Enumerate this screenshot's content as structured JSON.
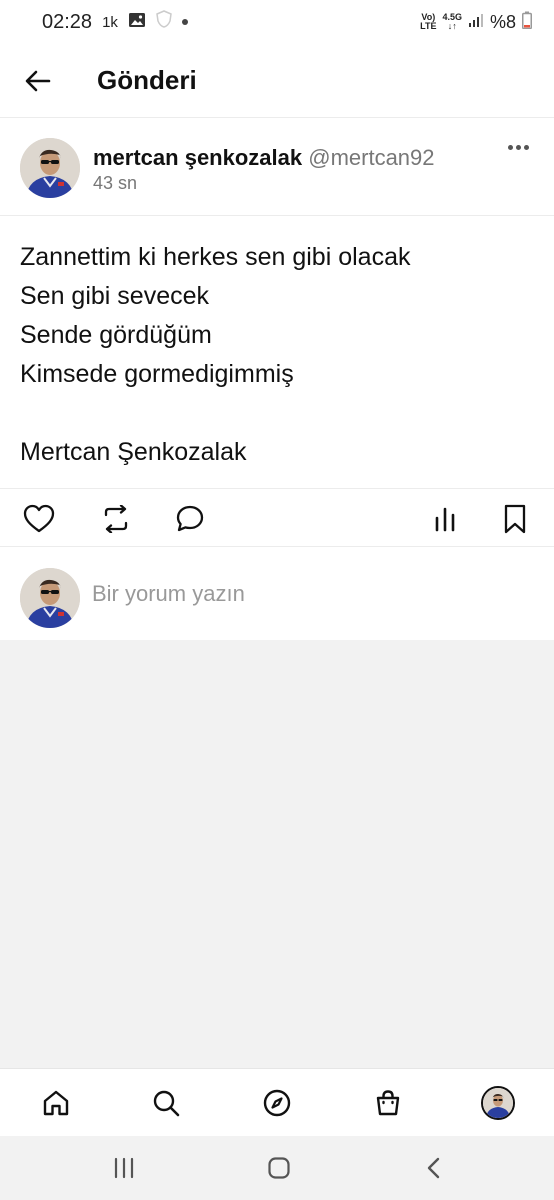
{
  "status_bar": {
    "time": "02:28",
    "notification_text": "1k",
    "network_top": "Vo)",
    "network_bottom": "LTE",
    "speed_top": "4.5G",
    "speed_bottom": "↓↑",
    "battery": "%8"
  },
  "header": {
    "title": "Gönderi",
    "back_icon": "arrow-left-icon"
  },
  "post": {
    "author_name": "mertcan şenkozalak",
    "author_handle": "@mertcan92",
    "time_ago": "43 sn",
    "lines": [
      "Zannettim ki herkes sen gibi olacak",
      "Sen gibi sevecek",
      "Sende gördüğüm",
      "Kimsede gormedigimmiş",
      "",
      "Mertcan Şenkozalak"
    ],
    "actions": [
      "heart-icon",
      "repost-icon",
      "comment-icon",
      "stats-icon",
      "bookmark-icon"
    ]
  },
  "comment": {
    "placeholder": "Bir yorum yazın"
  },
  "bottom_nav": {
    "items": [
      "home-icon",
      "search-icon",
      "explore-icon",
      "shop-bag-icon",
      "profile-avatar"
    ]
  },
  "system_nav": {
    "items": [
      "recents-icon",
      "home-circle-icon",
      "back-chevron-icon"
    ]
  },
  "colors": {
    "text": "#111111",
    "muted": "#777777",
    "divider": "#ececec",
    "background_gray": "#f2f2f2",
    "avatar_shirt": "#2a3fa0"
  }
}
